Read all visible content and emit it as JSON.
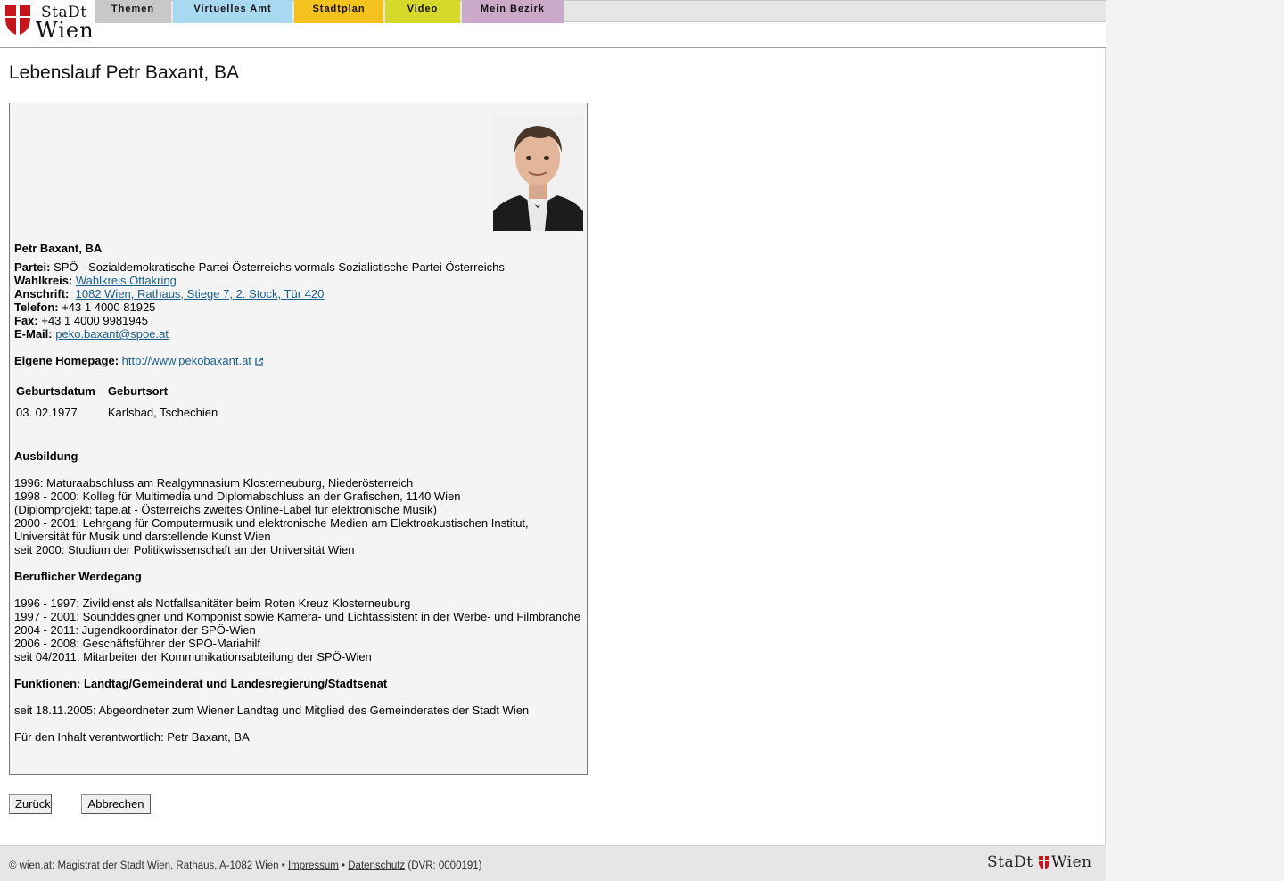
{
  "logo": {
    "line1": "StaDt",
    "line2": "Wien"
  },
  "nav": {
    "tabs": [
      "Themen",
      "Virtuelles Amt",
      "Stadtplan",
      "Video",
      "Mein Bezirk"
    ]
  },
  "page_title": "Lebenslauf Petr Baxant, BA",
  "profile": {
    "name": "Petr Baxant, BA",
    "partei_label": "Partei:",
    "partei": "SPÖ - Sozialdemokratische Partei Österreichs vormals Sozialistische Partei Österreichs",
    "wahlkreis_label": "Wahlkreis:",
    "wahlkreis": "Wahlkreis Ottakring",
    "anschrift_label": "Anschrift:",
    "anschrift": "1082 Wien, Rathaus, Stiege 7, 2. Stock, Tür 420",
    "telefon_label": "Telefon:",
    "telefon": "+43 1 4000 81925",
    "fax_label": "Fax:",
    "fax": "+43 1 4000 9981945",
    "email_label": "E-Mail:",
    "email": "peko.baxant@spoe.at",
    "homepage_label": "Eigene Homepage:",
    "homepage": "http://www.pekobaxant.at"
  },
  "birth_table": {
    "headers": [
      "Geburtsdatum",
      "Geburtsort"
    ],
    "row": [
      "03. 02.1977",
      "Karlsbad, Tschechien"
    ]
  },
  "ausbildung": {
    "title": "Ausbildung",
    "lines": [
      "1996: Maturaabschluss am Realgymnasium Klosterneuburg, Niederösterreich",
      "1998 - 2000: Kolleg für Multimedia und Diplomabschluss an der Grafischen, 1140 Wien",
      "(Diplomprojekt: tape.at - Österreichs zweites Online-Label für elektronische Musik)",
      "2000 - 2001: Lehrgang für Computermusik und elektronische Medien am Elektroakustischen Institut,",
      "Universität für Musik und darstellende Kunst Wien",
      "seit 2000: Studium der Politikwissenschaft an der Universität Wien"
    ]
  },
  "werdegang": {
    "title": "Beruflicher Werdegang",
    "lines": [
      "1996 - 1997: Zivildienst als Notfallsanitäter beim Roten Kreuz Klosterneuburg",
      "1997 - 2001: Sounddesigner und Komponist sowie Kamera- und Lichtassistent in der Werbe- und Filmbranche",
      "2004 - 2011: Jugendkoordinator der SPÖ-Wien",
      "2006 - 2008: Geschäftsführer der SPÖ-Mariahilf",
      "seit 04/2011: Mitarbeiter der Kommunikationsabteilung der SPÖ-Wien"
    ]
  },
  "funktionen": {
    "title": "Funktionen: Landtag/Gemeinderat und Landesregierung/Stadtsenat",
    "line": "seit 18.11.2005: Abgeordneter zum Wiener Landtag und Mitglied des Gemeinderates der Stadt Wien"
  },
  "verantwortlich": "Für den Inhalt verantwortlich: Petr Baxant, BA",
  "buttons": {
    "back": "Zurück",
    "cancel": "Abbrechen"
  },
  "footer": {
    "text": "© wien.at: Magistrat der Stadt Wien, Rathaus, A-1082 Wien •",
    "impressum": "Impressum",
    "sep": "•",
    "datenschutz": "Datenschutz",
    "dvr": "(DVR: 0000191)",
    "logo_a": "StaDt",
    "logo_b": "Wien"
  },
  "colors": {
    "tab_themen": "#c8c8c8",
    "tab_amt": "#a9d8f1",
    "tab_stadtplan": "#f4c21c",
    "tab_video": "#d6d92b",
    "tab_bezirk": "#cba9c8",
    "wien_red": "#c4161c",
    "link": "#1a5f8c"
  }
}
